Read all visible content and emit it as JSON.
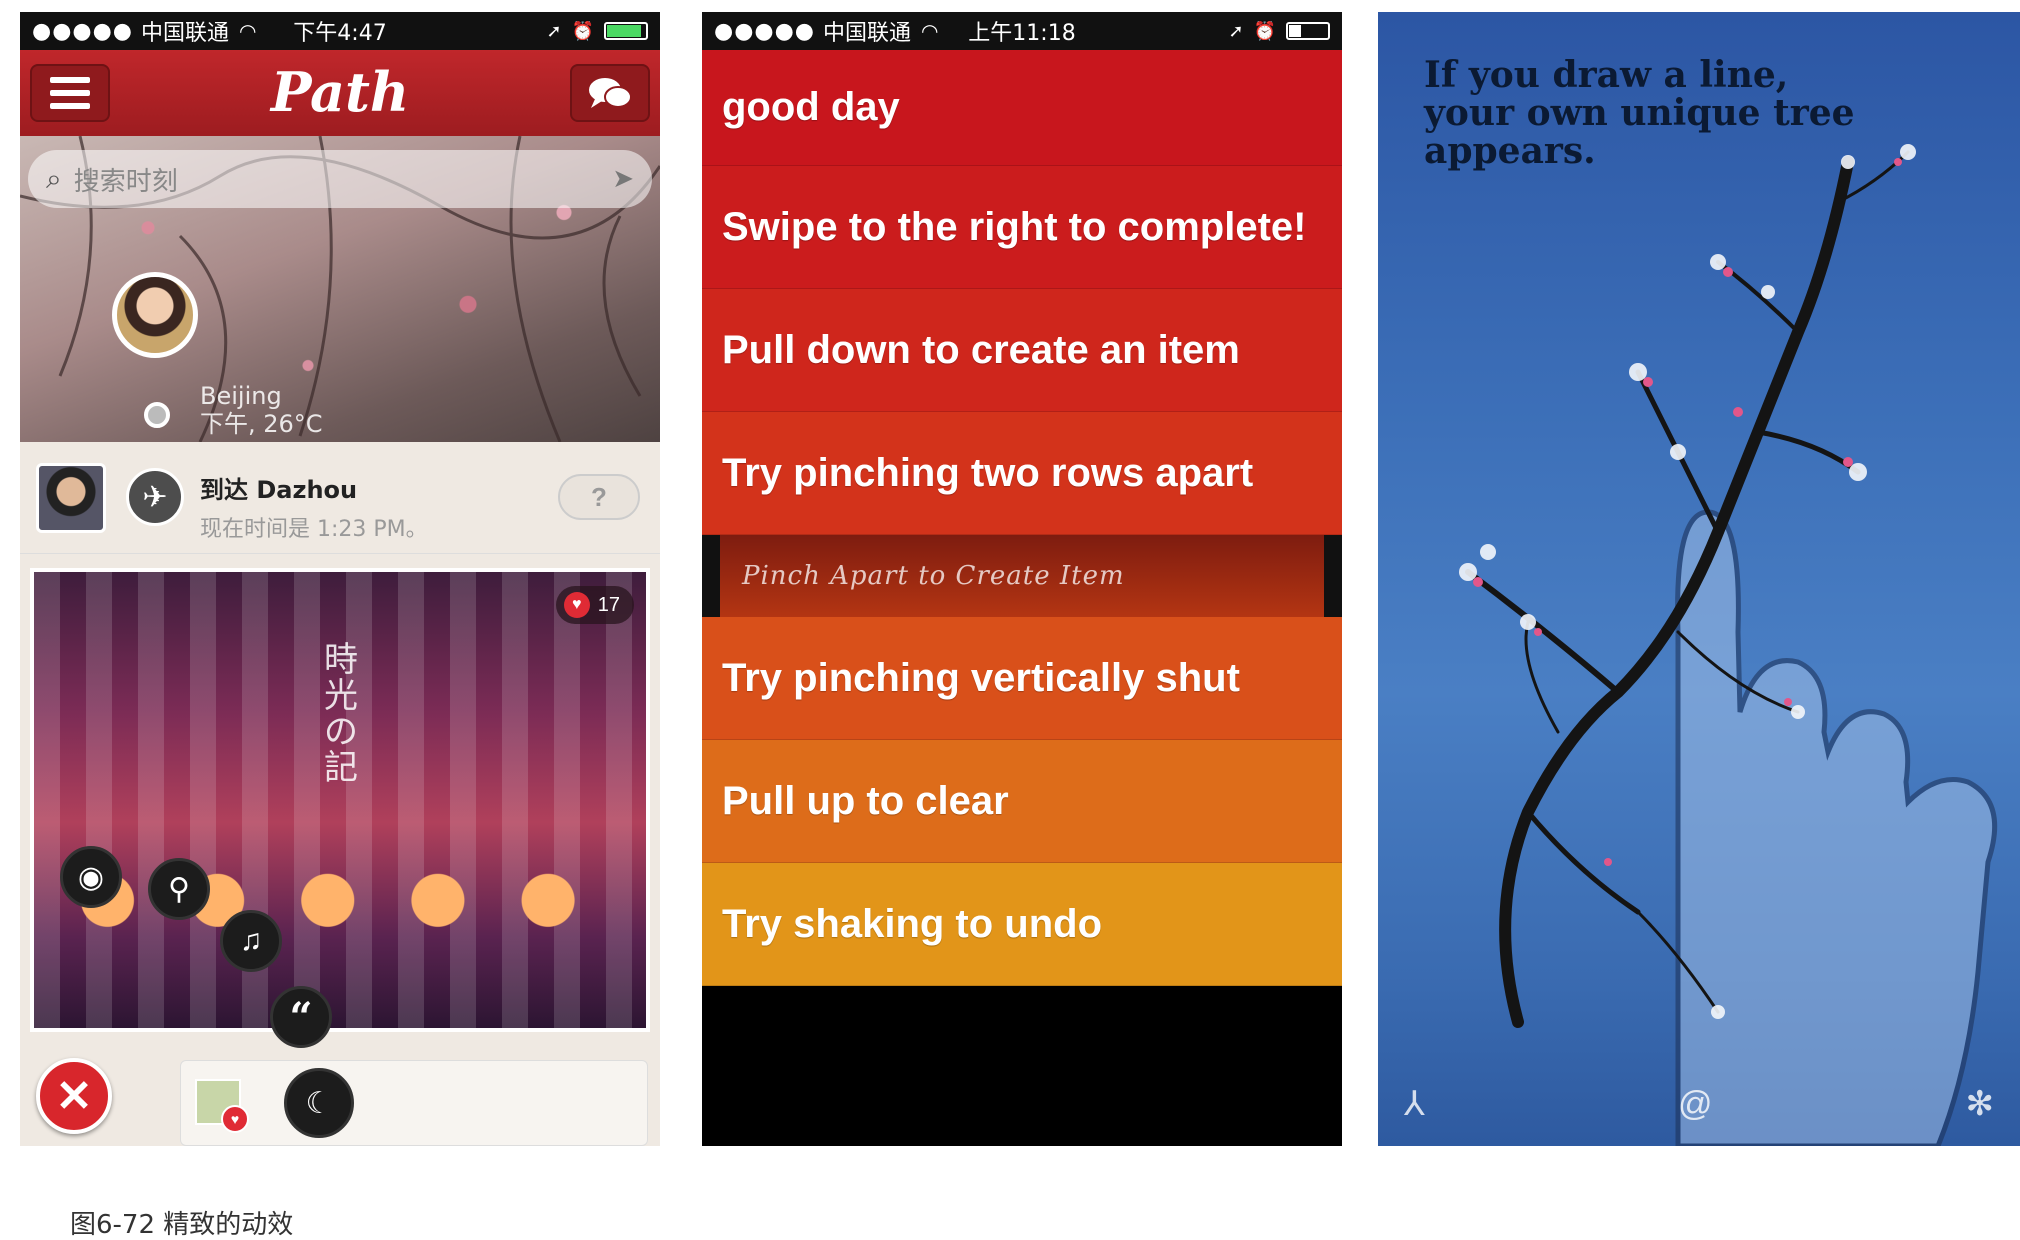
{
  "path_app": {
    "status": {
      "carrier": "中国联通",
      "time": "下午4:47",
      "battery_fraction": 0.85,
      "battery_color": "#4cd964"
    },
    "nav": {
      "logo": "Path"
    },
    "search": {
      "placeholder": "搜索时刻"
    },
    "cover": {
      "city": "Beijing",
      "weather": "下午, 26°C"
    },
    "moment": {
      "title": "到达 Dazhou",
      "subtitle": "现在时间是 1:23 PM。"
    },
    "photo": {
      "likes": "17",
      "vertical_text": "時光の記"
    }
  },
  "clear_app": {
    "status": {
      "carrier": "中国联通",
      "time": "上午11:18",
      "battery_fraction": 0.3,
      "battery_color": "#ffffff"
    },
    "items": [
      {
        "label": "good day",
        "color": "#c8161d"
      },
      {
        "label": "Swipe to the right to complete!",
        "color": "#cb1c1d"
      },
      {
        "label": "Pull down to create an item",
        "color": "#cf261c"
      },
      {
        "label": "Try pinching two rows apart",
        "color": "#d3331b"
      }
    ],
    "pinch_label": "Pinch Apart to Create Item",
    "items_after": [
      {
        "label": "Try pinching vertically shut",
        "color": "#d9501a"
      },
      {
        "label": "Pull up to clear",
        "color": "#dd6c1a"
      },
      {
        "label": "Try shaking to undo",
        "color": "#e29519"
      }
    ]
  },
  "tree_app": {
    "headline_line1": "If you draw a line,",
    "headline_line2": "your own unique tree appears."
  },
  "caption": "图6-72 精致的动效"
}
